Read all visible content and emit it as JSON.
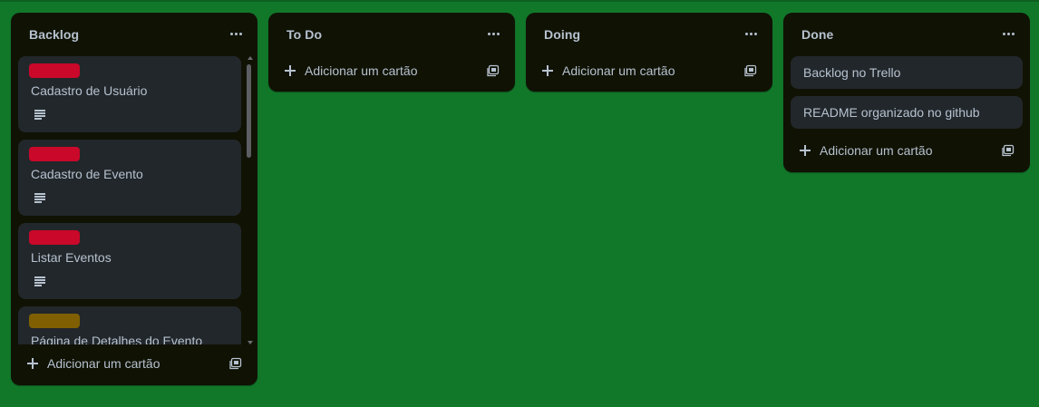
{
  "board": {
    "lists": [
      {
        "title": "Backlog",
        "cards": [
          {
            "title": "Cadastro de Usuário",
            "label_color": "#c9082a",
            "has_description": true
          },
          {
            "title": "Cadastro de Evento",
            "label_color": "#c9082a",
            "has_description": true
          },
          {
            "title": "Listar Eventos",
            "label_color": "#c9082a",
            "has_description": true
          },
          {
            "title": "Página de Detalhes do Evento",
            "label_color": "#7f5f01",
            "has_description": false
          }
        ],
        "add_card_label": "Adicionar um cartão"
      },
      {
        "title": "To Do",
        "cards": [],
        "add_card_label": "Adicionar um cartão"
      },
      {
        "title": "Doing",
        "cards": [],
        "add_card_label": "Adicionar um cartão"
      },
      {
        "title": "Done",
        "cards": [
          {
            "title": "Backlog no Trello"
          },
          {
            "title": "README organizado no github"
          }
        ],
        "add_card_label": "Adicionar um cartão"
      }
    ]
  },
  "icons": {
    "list_menu": "ellipsis-icon",
    "add": "plus-icon",
    "template": "card-template-icon",
    "description": "description-icon"
  },
  "colors": {
    "board_background": "#11782a",
    "list_background": "#101204",
    "card_background": "#22272b",
    "text": "#b6c2cf"
  }
}
